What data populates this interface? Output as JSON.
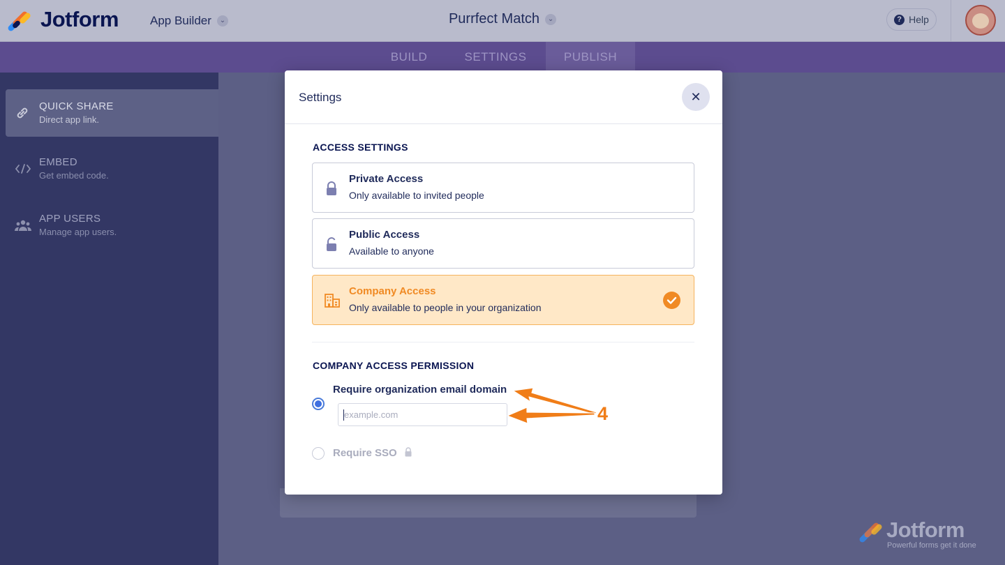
{
  "header": {
    "brand": "Jotform",
    "product_menu": "App Builder",
    "app_name": "Purrfect Match",
    "help_label": "Help"
  },
  "tabs": [
    {
      "label": "BUILD",
      "active": false
    },
    {
      "label": "SETTINGS",
      "active": false
    },
    {
      "label": "PUBLISH",
      "active": true
    }
  ],
  "sidebar": {
    "items": [
      {
        "title": "QUICK SHARE",
        "subtitle": "Direct app link.",
        "icon": "link-icon",
        "active": true
      },
      {
        "title": "EMBED",
        "subtitle": "Get embed code.",
        "icon": "code-icon",
        "active": false
      },
      {
        "title": "APP USERS",
        "subtitle": "Manage app users.",
        "icon": "users-icon",
        "active": false
      }
    ]
  },
  "modal": {
    "title": "Settings",
    "access_section_label": "ACCESS SETTINGS",
    "options": [
      {
        "title": "Private Access",
        "subtitle": "Only available to invited people",
        "icon": "lock-icon",
        "selected": false
      },
      {
        "title": "Public Access",
        "subtitle": "Available to anyone",
        "icon": "unlock-icon",
        "selected": false
      },
      {
        "title": "Company Access",
        "subtitle": "Only available to people in your organization",
        "icon": "building-icon",
        "selected": true
      }
    ],
    "permission_section_label": "COMPANY ACCESS PERMISSION",
    "permissions": {
      "email_domain_label": "Require organization email domain",
      "email_domain_placeholder": "example.com",
      "email_domain_value": "",
      "email_domain_selected": true,
      "sso_label": "Require SSO",
      "sso_locked": true
    }
  },
  "annotation": {
    "step_number": "4",
    "color": "#f07d18"
  },
  "watermark": {
    "brand": "Jotform",
    "tagline": "Powerful forms get it done"
  },
  "colors": {
    "brand_navy": "#0a1551",
    "accent_orange": "#f08a24",
    "selected_bg": "#ffe8c7",
    "radio_blue": "#3e6fe0",
    "tabbar_purple": "#5c4c8f"
  }
}
